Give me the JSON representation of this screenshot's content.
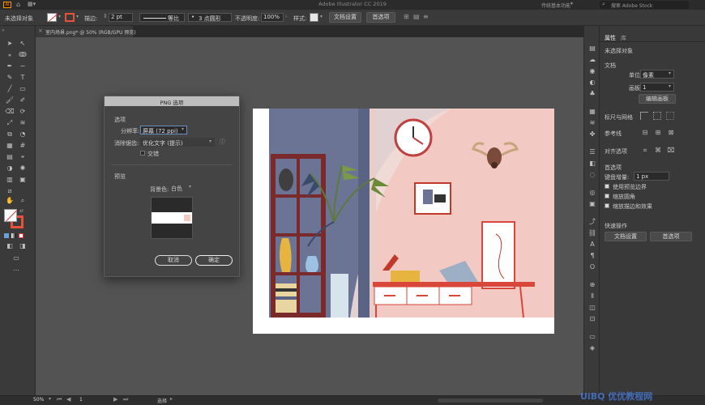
{
  "app": {
    "title": "Adobe Illustrator CC 2019",
    "workspace": "传统基本功能",
    "stock_search": "搜索 Adobe Stock"
  },
  "control_bar": {
    "selection_status": "未选择对象",
    "stroke_label": "描边:",
    "stroke_value": "2 pt",
    "stroke_profile": "等比",
    "brush": "3 点圆形",
    "opacity_label": "不透明度:",
    "opacity_value": "100%",
    "style_label": "样式:",
    "document_setup": "文档设置",
    "preferences": "首选项"
  },
  "document_tab": {
    "title": "室内场景.png* @ 50% (RGB/GPU 预览)"
  },
  "dialog": {
    "title": "PNG 选项",
    "options_section": "选项",
    "resolution_label": "分辨率:",
    "resolution_value": "屏幕 (72 ppi)",
    "antialias_label": "消除锯齿:",
    "antialias_value": "优化文字 (提示)",
    "interlace_label": "交错",
    "interlace_checked": false,
    "preview_section": "预览",
    "bg_label": "背景色:",
    "bg_value": "白色",
    "cancel": "取消",
    "ok": "确定"
  },
  "panel": {
    "tabs": [
      "属性",
      "库"
    ],
    "no_selection": "未选择对象",
    "document_section": "文档",
    "units_label": "单位:",
    "units_value": "像素",
    "artboard_label": "画板:",
    "artboard_value": "1",
    "edit_artboards": "编辑画板",
    "rulers_grids": "标尺与网格",
    "guides": "参考线",
    "align_to": "对齐选项",
    "preferences_section": "首选项",
    "keyboard_increment_label": "键盘增量:",
    "keyboard_increment_value": "1 px",
    "checks": [
      {
        "label": "使用预览边界",
        "checked": true
      },
      {
        "label": "缩放圆角",
        "checked": true
      },
      {
        "label": "缩放描边和效果",
        "checked": true
      }
    ],
    "quick_actions": "快速操作",
    "doc_setup_btn": "文档设置",
    "prefs_btn": "首选项"
  },
  "status_bar": {
    "zoom": "50%",
    "artboard": "1",
    "tool": "选择"
  },
  "watermark": "UiBQ 优优教程网",
  "colors": {
    "wall_pink": "#f3c9c4",
    "wall_blue": "#6b7494",
    "shelf_red": "#7a2a2a",
    "accent_red": "#d9473a",
    "plant_green": "#5d7a3a"
  }
}
